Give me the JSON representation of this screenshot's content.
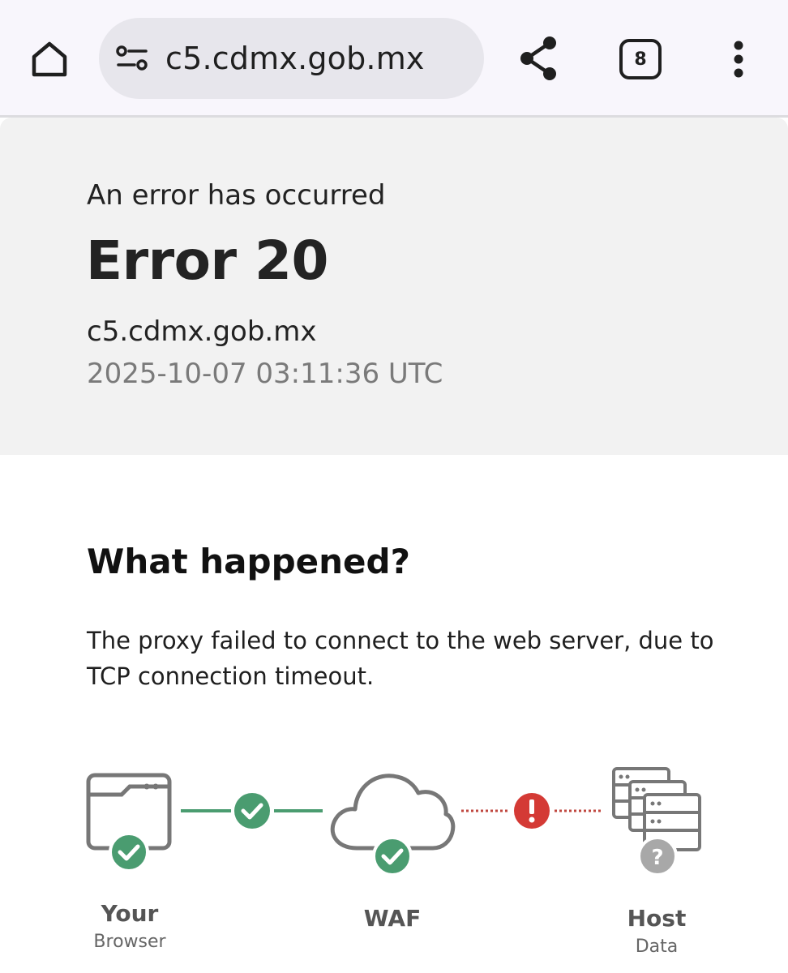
{
  "browser": {
    "url": "c5.cdmx.gob.mx",
    "tab_count": "8",
    "icons": [
      "home-icon",
      "site-settings-icon",
      "share-icon",
      "tab-switcher-icon",
      "more-vert-icon"
    ]
  },
  "error": {
    "subtitle": "An error has occurred",
    "title": "Error 20",
    "host": "c5.cdmx.gob.mx",
    "timestamp": "2025-10-07 03:11:36 UTC"
  },
  "what_happened": {
    "heading": "What happened?",
    "body": "The proxy failed to connect to the web server, due to TCP connection timeout."
  },
  "diagram": {
    "nodes": [
      {
        "title": "Your",
        "subtitle": "Browser",
        "status": "ok"
      },
      {
        "title": "WAF",
        "subtitle": "",
        "status": "ok"
      },
      {
        "title": "Host",
        "subtitle": "Data",
        "status": "unknown"
      }
    ],
    "links": [
      {
        "status": "ok"
      },
      {
        "status": "error"
      }
    ],
    "colors": {
      "ok": "#4a9c70",
      "error": "#d43a35",
      "unknown": "#a8a8a8",
      "icon_stroke": "#777777"
    }
  }
}
